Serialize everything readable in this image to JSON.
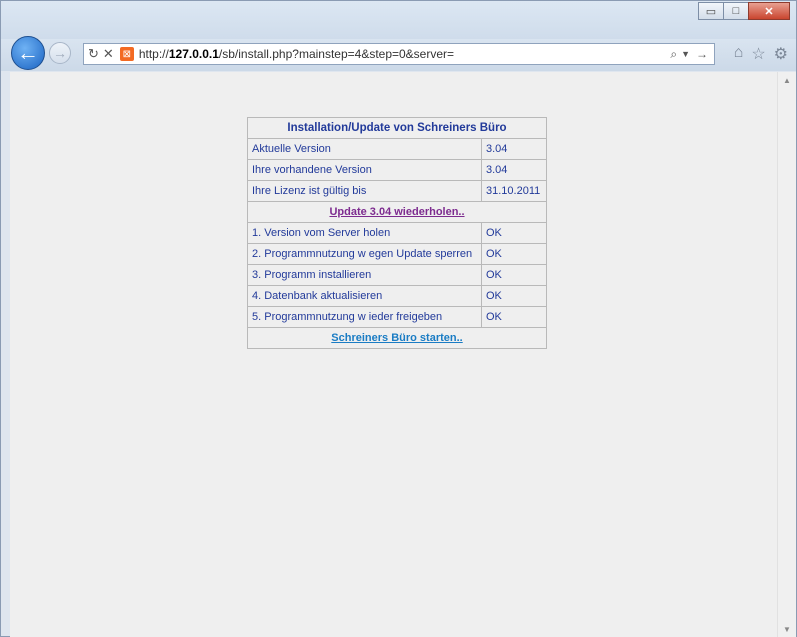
{
  "browser": {
    "url_host": "127.0.0.1",
    "url_prefix": "http://",
    "url_path": "/sb/install.php?mainstep=4&step=0&server=",
    "window_buttons": {
      "minimize": "▭",
      "maximize": "□",
      "close": "✕"
    },
    "icons": {
      "back": "back-arrow-icon",
      "forward": "forward-arrow-icon",
      "refresh": "refresh-icon",
      "stop": "stop-icon",
      "search": "search-icon",
      "home": "home-icon",
      "favorites": "star-icon",
      "settings": "gear-icon"
    }
  },
  "install": {
    "title": "Installation/Update von Schreiners Büro",
    "info_rows": [
      {
        "label": "Aktuelle Version",
        "value": "3.04"
      },
      {
        "label": "Ihre vorhandene Version",
        "value": "3.04"
      },
      {
        "label": "Ihre Lizenz ist gültig bis",
        "value": "31.10.2011"
      }
    ],
    "update_link": "Update 3.04 wiederholen..",
    "steps": [
      {
        "label": "1. Version vom Server holen",
        "status": "OK"
      },
      {
        "label": "2. Programmnutzung w egen Update sperren",
        "status": "OK"
      },
      {
        "label": "3. Programm installieren",
        "status": "OK"
      },
      {
        "label": "4. Datenbank aktualisieren",
        "status": "OK"
      },
      {
        "label": "5. Programmnutzung w ieder freigeben",
        "status": "OK"
      }
    ],
    "start_link": "Schreiners Büro starten.."
  },
  "colors": {
    "text": "#223a9a",
    "update_link": "#7d2b8f",
    "start_link": "#1a7cc4",
    "content_bg": "#efefef"
  }
}
